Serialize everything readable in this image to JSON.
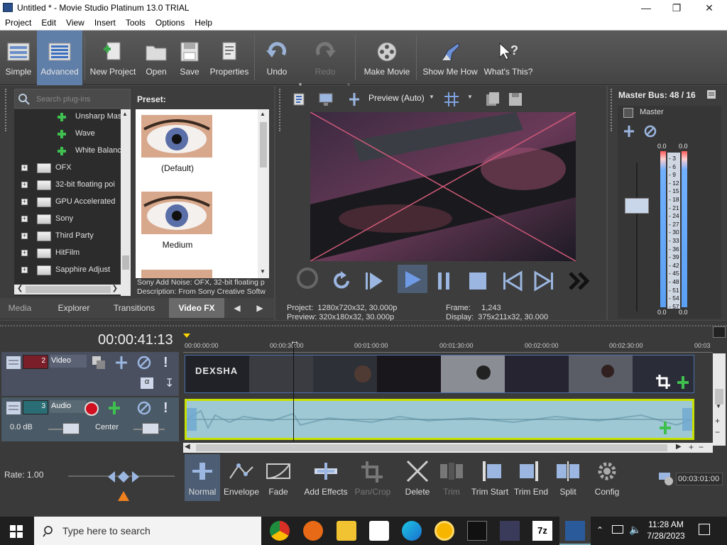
{
  "window": {
    "title": "Untitled * - Movie Studio Platinum 13.0 TRIAL"
  },
  "menu": [
    "Project",
    "Edit",
    "View",
    "Insert",
    "Tools",
    "Options",
    "Help"
  ],
  "toolbar": {
    "buttons": [
      "Simple",
      "Advanced",
      "New Project",
      "Open",
      "Save",
      "Properties",
      "Undo",
      "Redo",
      "Make Movie",
      "Show Me How",
      "What's This?"
    ]
  },
  "plugins": {
    "search_placeholder": "Search plug-ins",
    "tree": [
      "Unsharp Mas",
      "Wave",
      "White Balanc",
      "OFX",
      "32-bit floating poi",
      "GPU Accelerated",
      "Sony",
      "Third Party",
      "HitFilm",
      "Sapphire Adjust"
    ],
    "preset_label": "Preset:",
    "presets": [
      "(Default)",
      "Medium"
    ],
    "desc1": "Sony Add Noise: OFX, 32-bit floating p",
    "desc2": "Description: From Sony Creative Softw"
  },
  "tabs": [
    "Media",
    "Explorer",
    "Transitions",
    "Video FX"
  ],
  "preview": {
    "mode": "Preview (Auto)",
    "project_label": "Project:",
    "project": "1280x720x32, 30.000p",
    "preview_label": "Preview:",
    "preview": "320x180x32, 30.000p",
    "frame_label": "Frame:",
    "frame": "1,243",
    "display_label": "Display:",
    "display": "375x211x32, 30.000"
  },
  "master": {
    "title": "Master Bus: 48 / 16",
    "label": "Master",
    "peak_l": "0.0",
    "peak_r": "0.0",
    "bottom_l": "0.0",
    "bottom_r": "0.0",
    "scale": [
      "3",
      "6",
      "9",
      "12",
      "15",
      "18",
      "21",
      "24",
      "27",
      "30",
      "33",
      "36",
      "39",
      "42",
      "45",
      "48",
      "51",
      "54",
      "57"
    ]
  },
  "timeline": {
    "timecode": "00:00:41:13",
    "ruler": [
      "00:00:00:00",
      "00:00:30:00",
      "00:01:00:00",
      "00:01:30:00",
      "00:02:00:00",
      "00:02:30:00",
      "00:03"
    ],
    "video": {
      "num": "2",
      "name": "Video"
    },
    "audio": {
      "num": "3",
      "name": "Audio",
      "vol": "0.0 dB",
      "pan": "Center"
    }
  },
  "bottom": {
    "rate": "Rate: 1.00",
    "buttons": [
      "Normal",
      "Envelope",
      "Fade",
      "Add Effects",
      "Pan/Crop",
      "Delete",
      "Trim",
      "Trim Start",
      "Trim End",
      "Split",
      "Config"
    ],
    "end_time": "00:03:01:00"
  },
  "taskbar": {
    "search_placeholder": "Type here to search",
    "time": "11:28 AM",
    "date": "7/28/2023"
  }
}
